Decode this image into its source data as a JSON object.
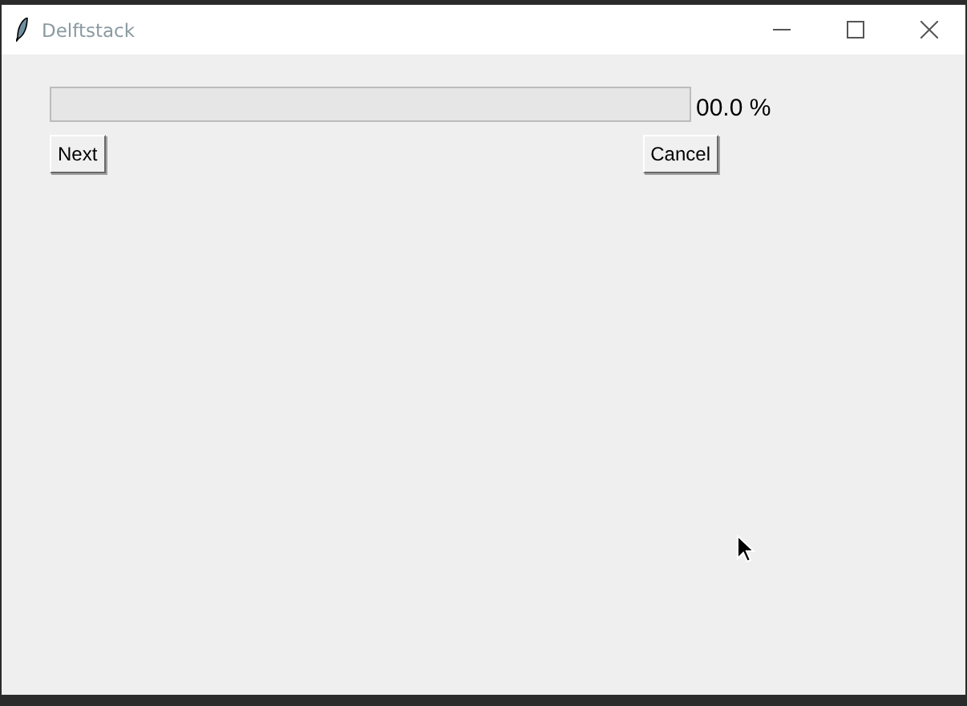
{
  "window": {
    "title": "Delftstack"
  },
  "progress": {
    "level": 0,
    "reading": "00.0 %"
  },
  "buttons": [
    {
      "label": "Next"
    },
    {
      "label": "Cancel"
    }
  ]
}
